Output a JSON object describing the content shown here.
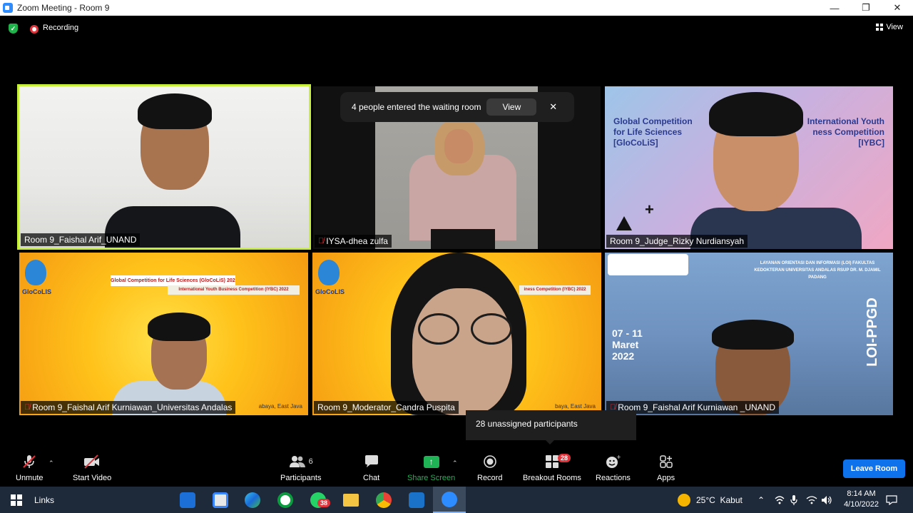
{
  "window": {
    "title": "Zoom Meeting - Room 9",
    "minimize": "—",
    "restore": "❐",
    "close": "✕"
  },
  "top": {
    "recording_label": "Recording",
    "view_label": "View"
  },
  "tiles": [
    {
      "name": "Room 9_Faishal Arif_UNAND",
      "muted": false
    },
    {
      "name": "IYSA-dhea zulfa",
      "muted": true
    },
    {
      "name": "Room 9_Judge_Rizky Nurdiansyah",
      "muted": false
    },
    {
      "name": "Room 9_Faishal Arif Kurniawan_Universitas Andalas",
      "muted": true
    },
    {
      "name": "Room 9_Moderator_Candra Puspita",
      "muted": false
    },
    {
      "name": "Room 9_Faishal Arif Kurniawan _UNAND",
      "muted": true
    }
  ],
  "backgrounds": {
    "t3_title_left": "Global Competition for Life Sciences [GloCoLiS]",
    "t3_title_right": "International Youth ness Competition [IYBC]",
    "t4_banner_1": "Global Competition for Life Sciences (GloCoLiS) 2022",
    "t4_banner_2": "International Youth Business Competition (IYBC) 2022",
    "t4_logo": "GloCoLIS",
    "t4_corner": "abaya, East Java",
    "t5_logo": "GloCoLIS",
    "t5_banner": "iness Competition (IYBC) 2022",
    "t5_corner": "baya, East Java",
    "t6_header": "LAYANAN ORIENTASI DAN INFORMASI (LOI) FAKULTAS KEDOKTERAN UNIVERSITAS ANDALAS RSUP DR. M. DJAMIL PADANG",
    "t6_date": "07 - 11 Maret 2022",
    "t6_vertical": "LOI-PPGD"
  },
  "toast": {
    "message": "4 people entered the waiting room",
    "view": "View",
    "close": "✕"
  },
  "tooltip": {
    "text": "28 unassigned participants"
  },
  "toolbar": {
    "unmute": "Unmute",
    "start_video": "Start Video",
    "participants": "Participants",
    "participants_count": "6",
    "chat": "Chat",
    "share_screen": "Share Screen",
    "record": "Record",
    "breakout_rooms": "Breakout Rooms",
    "breakout_count": "28",
    "reactions": "Reactions",
    "apps": "Apps",
    "leave": "Leave Room"
  },
  "taskbar": {
    "links": "Links",
    "whatsapp_badge": "38",
    "weather": "25°C  Kabut",
    "time": "8:14 AM",
    "date": "4/10/2022"
  },
  "colors": {
    "active_speaker": "#c7f03a",
    "leave": "#0e72ed",
    "share": "#1fb355",
    "badge": "#e0343c"
  }
}
